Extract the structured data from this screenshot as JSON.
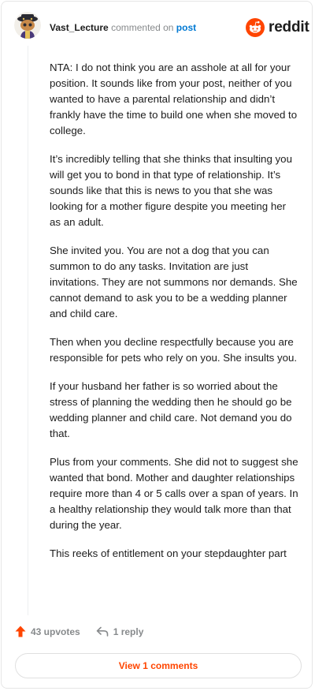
{
  "comment": {
    "username": "Vast_Lecture",
    "action": "commented on",
    "target": "post",
    "avatar_icon": "snoo-avatar-icon",
    "paragraphs": [
      "NTA: I do not think you are an asshole at all for your position. It sounds like from your post, neither of you wanted to have a parental relationship and didn’t frankly have the time to build one when she moved to college.",
      "It’s incredibly telling that she thinks that insulting you will get you to bond in that type of relationship. It’s sounds like that this is news to you that she was looking for a mother figure despite you meeting her as an adult.",
      "She invited you. You are not a dog that you can summon to do any tasks. Invitation are just invitations. They are not summons nor demands. She cannot demand to ask you to be a wedding planner and child care.",
      "Then when you decline respectfully because you are responsible for pets who rely on you. She insults you.",
      "If your husband her father is so worried about the stress of planning the wedding then he should go be wedding planner and child care. Not demand you do that.",
      "Plus from your comments. She did not to suggest she wanted that bond. Mother and daughter relationships require more than 4 or 5 calls over a span of years. In a healthy relationship they would talk more than that during the year.",
      "This reeks of entitlement on your stepdaughter part"
    ]
  },
  "brand": {
    "wordmark": "reddit",
    "icon": "reddit-alien-icon",
    "color": "#ff4500"
  },
  "footer": {
    "upvotes": "43 upvotes",
    "upvote_icon": "upvote-arrow-icon",
    "replies": "1 reply",
    "reply_icon": "reply-arrow-icon",
    "view_comments": "View 1 comments"
  },
  "colors": {
    "accent": "#ff4500",
    "link": "#0079d3",
    "muted": "#878a8c"
  }
}
